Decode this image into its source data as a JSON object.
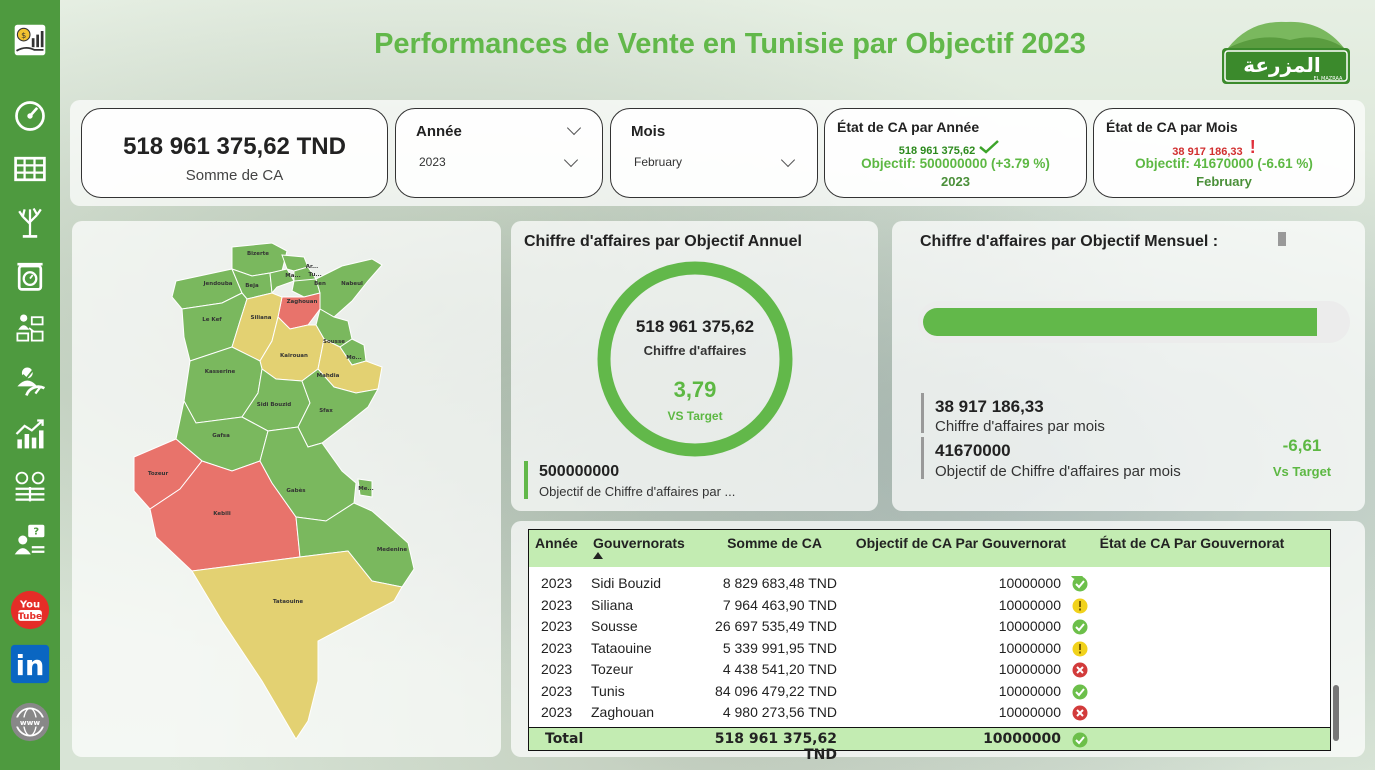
{
  "title": "Performances de Vente en Tunisie par Objectif 2023",
  "logo": {
    "text_ar": "المزرعة",
    "text_en": "EL MAZRAA"
  },
  "sidebar": {
    "icons": [
      {
        "name": "sales-growth-icon"
      },
      {
        "name": "speedometer-icon"
      },
      {
        "name": "table-icon"
      },
      {
        "name": "tree-icon"
      },
      {
        "name": "scale-icon"
      },
      {
        "name": "distribution-icon"
      },
      {
        "name": "target-gauge-icon"
      },
      {
        "name": "growth-chart-icon"
      },
      {
        "name": "comparison-icon"
      },
      {
        "name": "question-person-icon"
      },
      {
        "name": "youtube-icon",
        "label_top": "You",
        "label_bottom": "Tube",
        "color": "#e52d27"
      },
      {
        "name": "linkedin-icon",
        "label": "in",
        "color": "#0a66c2"
      },
      {
        "name": "globe-www-icon",
        "label": "www"
      }
    ]
  },
  "kpi": {
    "total_value": "518 961 375,62 TND",
    "total_label": "Somme de CA"
  },
  "slicers": {
    "year": {
      "label": "Année",
      "value": "2023"
    },
    "month": {
      "label": "Mois",
      "value": "February"
    }
  },
  "state_year": {
    "title": "État de CA par Année",
    "value": "518 961 375,62",
    "objective": "Objectif: 500000000 (+3.79 %)",
    "period": "2023"
  },
  "state_month": {
    "title": "État de CA par Mois",
    "value": "38 917 186,33",
    "alert": "!",
    "objective": "Objectif: 41670000 (-6.61 %)",
    "period": "February"
  },
  "map": {
    "regions": [
      {
        "name": "Bizerte",
        "status": "ok"
      },
      {
        "name": "Jendouba",
        "status": "ok"
      },
      {
        "name": "Beja",
        "status": "ok"
      },
      {
        "name": "Ma...",
        "status": "ok"
      },
      {
        "name": "Ar...",
        "status": "ok"
      },
      {
        "name": "Tu...",
        "status": "ok"
      },
      {
        "name": "Ben",
        "status": "ok"
      },
      {
        "name": "Nabeul",
        "status": "ok"
      },
      {
        "name": "Zaghouan",
        "status": "bad"
      },
      {
        "name": "Le Kef",
        "status": "ok"
      },
      {
        "name": "Siliana",
        "status": "warn"
      },
      {
        "name": "Sousse",
        "status": "ok"
      },
      {
        "name": "Kairouan",
        "status": "warn"
      },
      {
        "name": "Mo...",
        "status": "ok"
      },
      {
        "name": "Kasserine",
        "status": "ok"
      },
      {
        "name": "Mahdia",
        "status": "warn"
      },
      {
        "name": "Sidi Bouzid",
        "status": "ok"
      },
      {
        "name": "Sfax",
        "status": "ok"
      },
      {
        "name": "Gafsa",
        "status": "ok"
      },
      {
        "name": "Tozeur",
        "status": "bad"
      },
      {
        "name": "Kebili",
        "status": "bad"
      },
      {
        "name": "Gabès",
        "status": "ok"
      },
      {
        "name": "Me...",
        "status": "ok"
      },
      {
        "name": "Medenine",
        "status": "ok"
      },
      {
        "name": "Tataouine",
        "status": "warn"
      }
    ],
    "colors": {
      "ok": "#7ab85e",
      "warn": "#e3d172",
      "bad": "#e8736b"
    }
  },
  "annual": {
    "title": "Chiffre d'affaires par Objectif Annuel",
    "value": "518 961 375,62",
    "value_label": "Chiffre d'affaires",
    "pct": "3,79",
    "pct_label": "VS Target",
    "objective_value": "500000000",
    "objective_label": "Objectif de Chiffre d'affaires par ...",
    "ring_color": "#62b84a"
  },
  "monthly": {
    "title": "Chiffre d'affaires par Objectif Mensuel :",
    "bar_fill_fraction": 0.934,
    "bar_color": "#62b84a",
    "value": "38 917 186,33",
    "value_label": "Chiffre d'affaires par mois",
    "objective_value": "41670000",
    "objective_label": "Objectif de Chiffre d'affaires par mois",
    "pct": "-6,61",
    "pct_label": "Vs Target"
  },
  "table": {
    "headers": [
      "Année",
      "Gouvernorats",
      "Somme de CA",
      "Objectif de CA Par Gouvernorat",
      "État de CA Par Gouvernorat"
    ],
    "rows": [
      {
        "year": "2023",
        "gov": "Sidi Bouzid",
        "ca": "8 829 683,48 TND",
        "obj": "10000000",
        "state": "ok"
      },
      {
        "year": "2023",
        "gov": "Siliana",
        "ca": "7 964 463,90 TND",
        "obj": "10000000",
        "state": "warn"
      },
      {
        "year": "2023",
        "gov": "Sousse",
        "ca": "26 697 535,49 TND",
        "obj": "10000000",
        "state": "ok"
      },
      {
        "year": "2023",
        "gov": "Tataouine",
        "ca": "5 339 991,95 TND",
        "obj": "10000000",
        "state": "warn"
      },
      {
        "year": "2023",
        "gov": "Tozeur",
        "ca": "4 438 541,20 TND",
        "obj": "10000000",
        "state": "bad"
      },
      {
        "year": "2023",
        "gov": "Tunis",
        "ca": "84 096 479,22 TND",
        "obj": "10000000",
        "state": "ok"
      },
      {
        "year": "2023",
        "gov": "Zaghouan",
        "ca": "4 980 273,56 TND",
        "obj": "10000000",
        "state": "bad"
      }
    ],
    "total": {
      "label": "Total",
      "ca": "518 961 375,62 TND",
      "obj": "10000000",
      "state": "ok"
    },
    "state_colors": {
      "ok": "#6cbf4a",
      "warn": "#f1d21b",
      "bad": "#d23b3b"
    }
  }
}
